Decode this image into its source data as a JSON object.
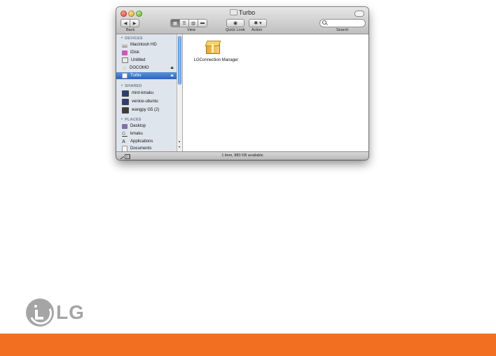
{
  "window": {
    "title": "Turbo",
    "toolbar": {
      "back_label": "Back",
      "view_label": "View",
      "quicklook_label": "Quick Look",
      "action_label": "Action",
      "search_label": "Search",
      "search_placeholder": ""
    }
  },
  "sidebar": {
    "devices_header": "DEVICES",
    "devices": [
      {
        "label": "Macintosh HD"
      },
      {
        "label": "iDisk"
      },
      {
        "label": "Untitled"
      },
      {
        "label": "DOCOMO"
      },
      {
        "label": "Turbo"
      }
    ],
    "shared_header": "SHARED",
    "shared": [
      {
        "label": "mint-kmaku"
      },
      {
        "label": "venice-ubuntu"
      },
      {
        "label": "wangpy G5 (2)"
      }
    ],
    "places_header": "PLACES",
    "places": [
      {
        "label": "Desktop"
      },
      {
        "label": "kmaku"
      },
      {
        "label": "Applications"
      },
      {
        "label": "Documents"
      }
    ]
  },
  "content": {
    "files": [
      {
        "name": "LGConnection Manager"
      }
    ]
  },
  "status": {
    "text": "1 item, 880 KB available"
  },
  "brand": {
    "name": "LG",
    "accent_color": "#f26f21",
    "logo_color": "#a5a5a5"
  }
}
